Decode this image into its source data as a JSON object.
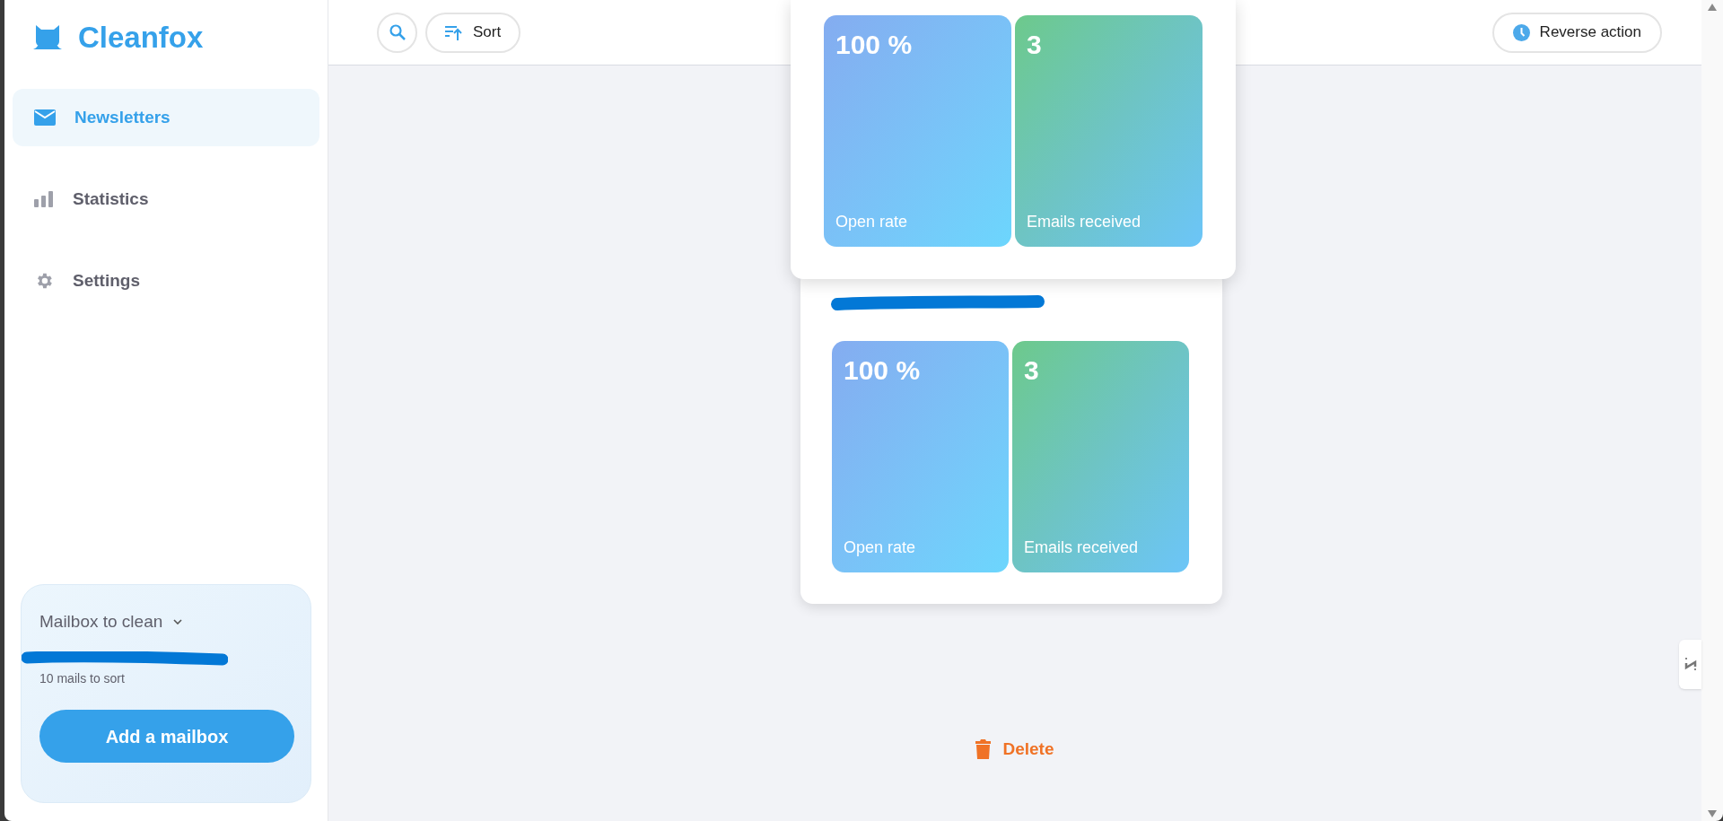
{
  "sidebar": {
    "logo": "Cleanfox",
    "items": [
      {
        "kind": "mail",
        "label": "Newsletters",
        "selected": true
      },
      {
        "kind": "stats",
        "label": "Statistics",
        "selected": false
      },
      {
        "kind": "gear",
        "label": "Settings",
        "selected": false
      }
    ],
    "mailbox": {
      "title": "Mailbox to clean",
      "count": "10 mails to sort",
      "button": "Add a mailbox"
    }
  },
  "toolbar": {
    "sort": "Sort",
    "reverse": "Reverse action"
  },
  "cards": [
    {
      "stats": [
        {
          "kind": "rate",
          "value": "100 %",
          "label": "Open rate"
        },
        {
          "kind": "count",
          "value": "3",
          "label": "Emails received"
        }
      ]
    },
    {
      "stats": [
        {
          "kind": "rate",
          "value": "100 %",
          "label": "Open rate"
        },
        {
          "kind": "count",
          "value": "3",
          "label": "Emails received"
        }
      ]
    }
  ],
  "delete": "Delete"
}
